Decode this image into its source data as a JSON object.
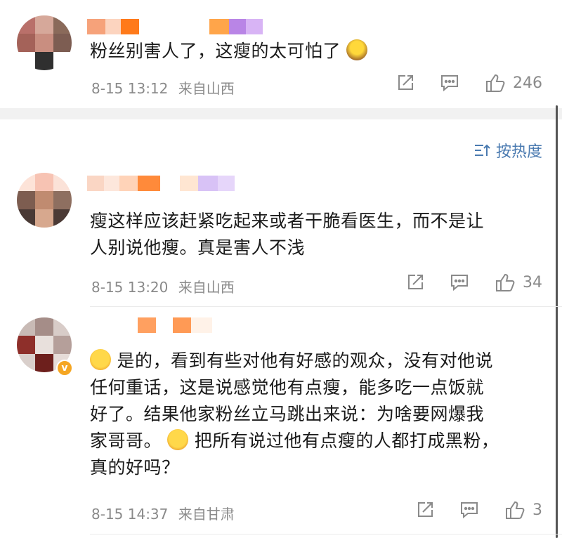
{
  "comments": [
    {
      "text": "粉丝别害人了，这瘦的太可怕了",
      "time": "8-15 13:12",
      "location": "来自山西",
      "likes": "246"
    },
    {
      "text_line1": "瘦这样应该赶紧吃起来或者干脆看医生，而不是让",
      "text_line2": "人别说他瘦。真是害人不浅",
      "time": "8-15 13:20",
      "location": "来自山西",
      "likes": "34"
    },
    {
      "text_line1": "是的，看到有些对他有好感的观众，没有对他说",
      "text_line2": "任何重话，这是说感觉他有点瘦，能多吃一点饭就",
      "text_line3": "好了。结果他家粉丝立马跳出来说：为啥要网爆我",
      "text_line4a": "家哥哥。",
      "text_line4b": "把所有说过他有点瘦的人都打成黑粉，",
      "text_line5": "真的好吗？",
      "time": "8-15 14:37",
      "location": "来自甘肃",
      "likes": "3"
    }
  ],
  "sort": {
    "label": "按热度"
  },
  "icons": {
    "repost": "repost-icon",
    "comment": "comment-icon",
    "like": "thumbs-up-icon",
    "sort": "sort-icon"
  },
  "colors": {
    "accent": "#4a7ab0",
    "meta": "#8a8a8a",
    "divider": "#f1f1f1",
    "vip": "#f5a623"
  }
}
